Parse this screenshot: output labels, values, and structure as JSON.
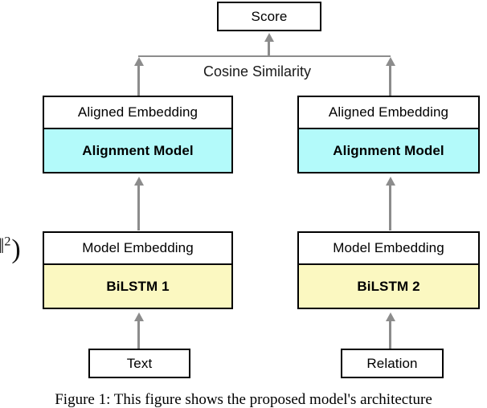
{
  "figure": {
    "caption": "Figure 1: This figure shows the proposed model's architecture",
    "math_fragment": {
      "norm_bars": "‖",
      "exponent": "2",
      "closing_paren": ")"
    }
  },
  "nodes": {
    "score": {
      "label": "Score"
    },
    "cosine_similarity": {
      "label": "Cosine Similarity"
    },
    "left_branch": {
      "aligned_embedding": {
        "label": "Aligned Embedding"
      },
      "alignment_model": {
        "label": "Alignment Model",
        "color": "#b3fafa"
      },
      "model_embedding": {
        "label": "Model Embedding"
      },
      "encoder": {
        "label": "BiLSTM 1",
        "color": "#fbf8c1"
      },
      "input": {
        "label": "Text"
      }
    },
    "right_branch": {
      "aligned_embedding": {
        "label": "Aligned Embedding"
      },
      "alignment_model": {
        "label": "Alignment Model",
        "color": "#b3fafa"
      },
      "model_embedding": {
        "label": "Model Embedding"
      },
      "encoder": {
        "label": "BiLSTM 2",
        "color": "#fbf8c1"
      },
      "input": {
        "label": "Relation"
      }
    }
  },
  "colors": {
    "box_border": "#000000",
    "arrow": "#8c8c8c",
    "alignment_fill": "#b3fafa",
    "bilstm_fill": "#fbf8c1",
    "background": "#ffffff"
  }
}
